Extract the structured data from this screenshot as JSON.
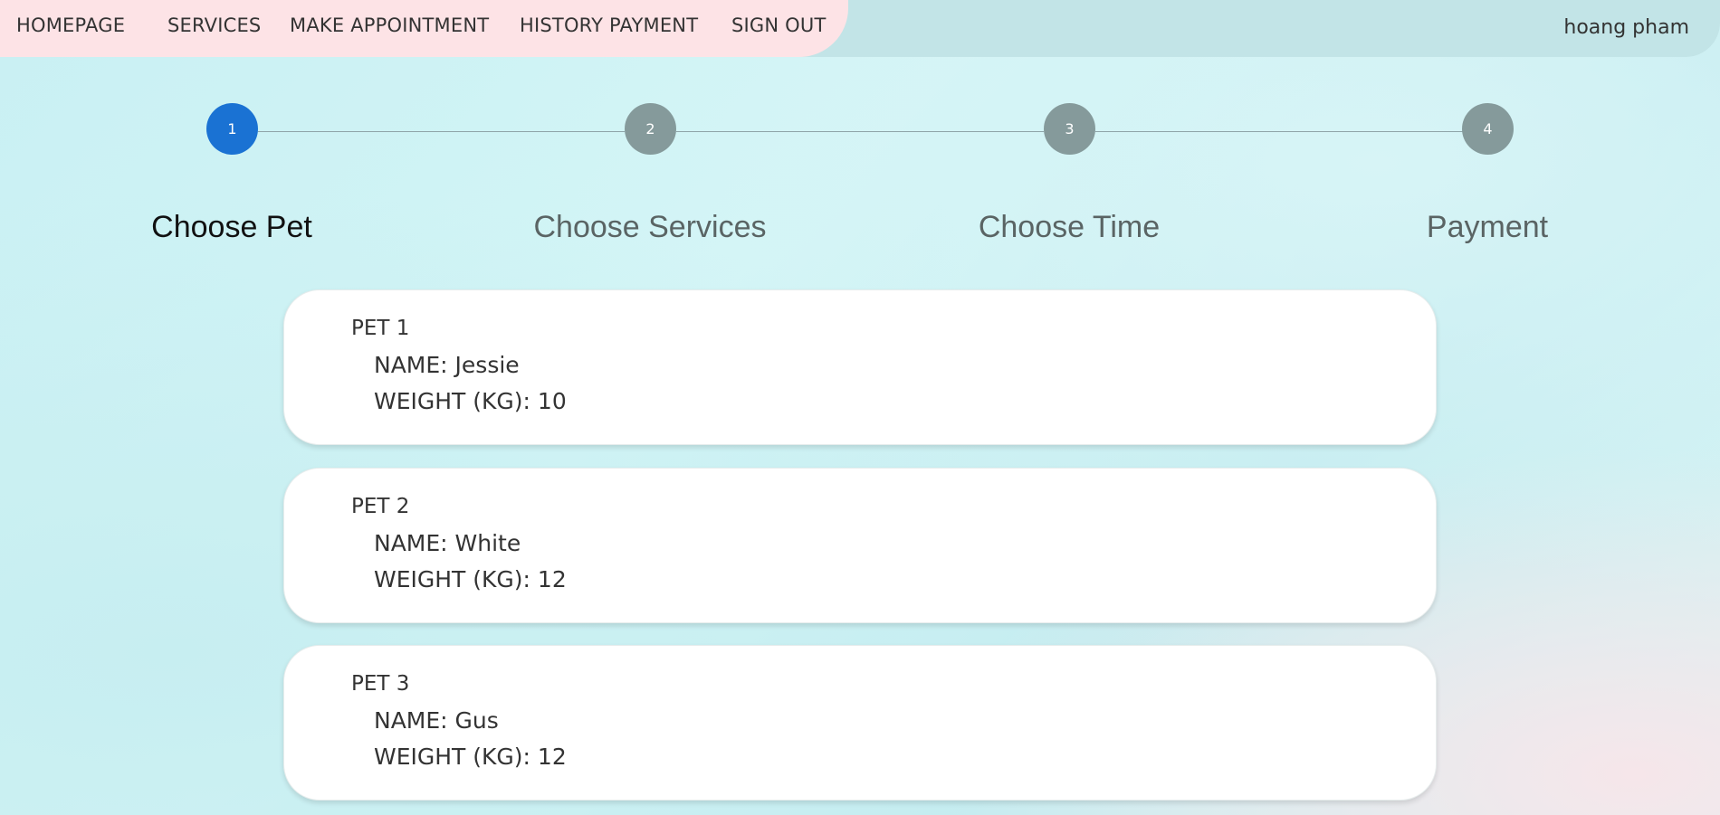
{
  "nav": {
    "items": [
      "HOMEPAGE",
      "SERVICES",
      "MAKE APPOINTMENT",
      "HISTORY PAYMENT",
      "SIGN OUT"
    ],
    "user_name": "hoang pham"
  },
  "steps": [
    {
      "number": "1",
      "label": "Choose Pet"
    },
    {
      "number": "2",
      "label": "Choose Services"
    },
    {
      "number": "3",
      "label": "Choose Time"
    },
    {
      "number": "4",
      "label": "Payment"
    }
  ],
  "active_step": 1,
  "pet_labels": {
    "name": "NAME: ",
    "weight": "WEIGHT (KG): "
  },
  "pets": [
    {
      "title": "PET 1",
      "name": "Jessie",
      "weight": "10"
    },
    {
      "title": "PET 2",
      "name": "White",
      "weight": "12"
    },
    {
      "title": "PET 3",
      "name": "Gus",
      "weight": "12"
    }
  ],
  "colors": {
    "nav_bg": "#fde3e6",
    "header_bg": "#c2e4e7",
    "active_step": "#1a72d3",
    "inactive_step": "#859a9b"
  }
}
